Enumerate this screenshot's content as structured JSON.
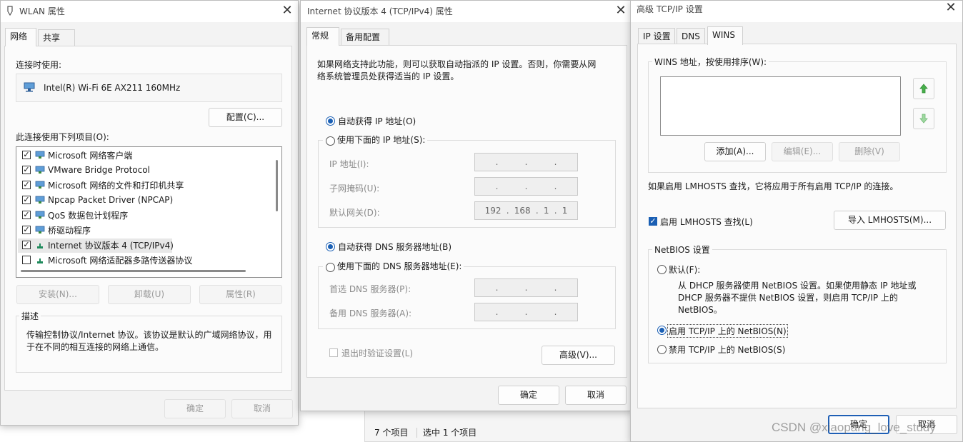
{
  "wlan_dialog": {
    "title": "WLAN 属性",
    "tabs": [
      "网络",
      "共享"
    ],
    "connect_using_label": "连接时使用:",
    "adapter_name": "Intel(R) Wi-Fi 6E AX211 160MHz",
    "configure_button": "配置(C)...",
    "items_label": "此连接使用下列项目(O):",
    "items": [
      {
        "label": "Microsoft 网络客户端",
        "checked": true,
        "icon": "network-client-icon"
      },
      {
        "label": "VMware Bridge Protocol",
        "checked": true,
        "icon": "network-client-icon"
      },
      {
        "label": "Microsoft 网络的文件和打印机共享",
        "checked": true,
        "icon": "network-client-icon"
      },
      {
        "label": "Npcap Packet Driver (NPCAP)",
        "checked": true,
        "icon": "network-client-icon"
      },
      {
        "label": "QoS 数据包计划程序",
        "checked": true,
        "icon": "network-client-icon"
      },
      {
        "label": "桥驱动程序",
        "checked": true,
        "icon": "network-client-icon"
      },
      {
        "label": "Internet 协议版本 4 (TCP/IPv4)",
        "checked": true,
        "icon": "protocol-icon"
      },
      {
        "label": "Microsoft 网络适配器多路传送器协议",
        "checked": false,
        "icon": "protocol-icon"
      }
    ],
    "install_button": "安装(N)...",
    "uninstall_button": "卸载(U)",
    "properties_button": "属性(R)",
    "description_label": "描述",
    "description_text_1": "传输控制协议/Internet 协议。该协议是默认的广域网络协议，用",
    "description_text_2": "于在不同的相互连接的网络上通信。",
    "ok_button": "确定",
    "cancel_button": "取消"
  },
  "ipv4_dialog": {
    "title": "Internet 协议版本 4 (TCP/IPv4) 属性",
    "tabs": [
      "常规",
      "备用配置"
    ],
    "intro_1": "如果网络支持此功能，则可以获取自动指派的 IP 设置。否则，你需要从网",
    "intro_2": "络系统管理员处获得适当的 IP 设置。",
    "auto_ip": "自动获得 IP 地址(O)",
    "manual_ip": "使用下面的 IP 地址(S):",
    "ip_address_label": "IP 地址(I):",
    "subnet_label": "子网掩码(U):",
    "gateway_label": "默认网关(D):",
    "gateway_octets": [
      "192",
      "168",
      "1",
      "1"
    ],
    "auto_dns": "自动获得 DNS 服务器地址(B)",
    "manual_dns": "使用下面的 DNS 服务器地址(E):",
    "preferred_dns_label": "首选 DNS 服务器(P):",
    "alternate_dns_label": "备用 DNS 服务器(A):",
    "validate_label": "退出时验证设置(L)",
    "advanced_button": "高级(V)...",
    "ok_button": "确定",
    "cancel_button": "取消"
  },
  "explorer_status": {
    "items_count": "7 个项目",
    "selected_count": "选中 1 个项目"
  },
  "advanced_dialog": {
    "title": "高级 TCP/IP 设置",
    "tabs": [
      "IP 设置",
      "DNS",
      "WINS"
    ],
    "wins_label": "WINS 地址，按使用排序(W):",
    "add_button": "添加(A)...",
    "edit_button": "编辑(E)...",
    "delete_button": "删除(V)",
    "lmhosts_note": "如果启用 LMHOSTS 查找，它将应用于所有启用 TCP/IP 的连接。",
    "enable_lmhosts": "启用 LMHOSTS 查找(L)",
    "import_button": "导入 LMHOSTS(M)...",
    "netbios_label": "NetBIOS 设置",
    "default_option": "默认(F):",
    "default_desc_1": "从 DHCP 服务器使用 NetBIOS 设置。如果使用静态 IP 地址或",
    "default_desc_2": "DHCP 服务器不提供 NetBIOS 设置，则启用 TCP/IP 上的",
    "default_desc_3": "NetBIOS。",
    "enable_netbios": "启用 TCP/IP 上的 NetBIOS(N)",
    "disable_netbios": "禁用 TCP/IP 上的 NetBIOS(S)",
    "ok_button": "确定",
    "cancel_button": "取消"
  },
  "watermark": "CSDN @xiaopang_love_study",
  "colors": {
    "accent": "#1a5fb4",
    "up_arrow": "#2e9a3c"
  }
}
